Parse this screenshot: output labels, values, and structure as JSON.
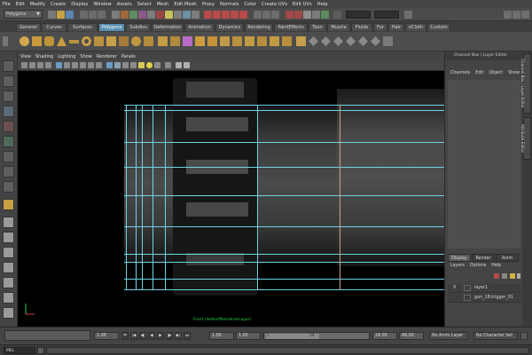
{
  "menubar": {
    "items": [
      "File",
      "Edit",
      "Modify",
      "Create",
      "Display",
      "Window",
      "Assets",
      "Select",
      "Mesh",
      "Edit Mesh",
      "Proxy",
      "Normals",
      "Color",
      "Create UVs",
      "Edit UVs",
      "Help"
    ]
  },
  "statusline": {
    "mode_selector": "Polygons"
  },
  "shelf": {
    "tabs": [
      "General",
      "Curves",
      "Surfaces",
      "Polygons",
      "Subdivs",
      "Deformation",
      "Animation",
      "Dynamics",
      "Rendering",
      "PaintEffects",
      "Toon",
      "Muscle",
      "Fluids",
      "Fur",
      "Hair",
      "nCloth",
      "Custom"
    ],
    "active_tab": "Polygons"
  },
  "panel": {
    "menu": [
      "View",
      "Shading",
      "Lighting",
      "Show",
      "Renderer",
      "Panels"
    ],
    "camera_label": "Front (defaultRendererLayer)"
  },
  "channel_box": {
    "header": "Channel Box / Layer Editor",
    "menu": [
      "Channels",
      "Edit",
      "Object",
      "Show"
    ],
    "layer_tabs": [
      "Display",
      "Render",
      "Anim"
    ],
    "layer_menu": [
      "Layers",
      "Options",
      "Help"
    ],
    "layers": [
      {
        "visible": "V",
        "name": "layer1"
      },
      {
        "visible": "",
        "name": "gun_18:trigger_01"
      }
    ]
  },
  "side_tabs": [
    "Channel Box / Layer Editor",
    "Attribute Editor"
  ],
  "time_slider": {
    "current_frame": "1.00",
    "range_start": "1.00",
    "playback_start": "1.00",
    "range_handle_start": "1",
    "range_handle_end": "24",
    "playback_end": "24.00",
    "range_end": "48.00",
    "anim_layer": "No Anim Layer",
    "character_set": "No Character Set"
  },
  "command_line": {
    "language": "MEL"
  },
  "colors": {
    "wireframe": "#6fd3e6",
    "active_tab": "#5a8fb0",
    "camera_label": "#2bd24a"
  }
}
